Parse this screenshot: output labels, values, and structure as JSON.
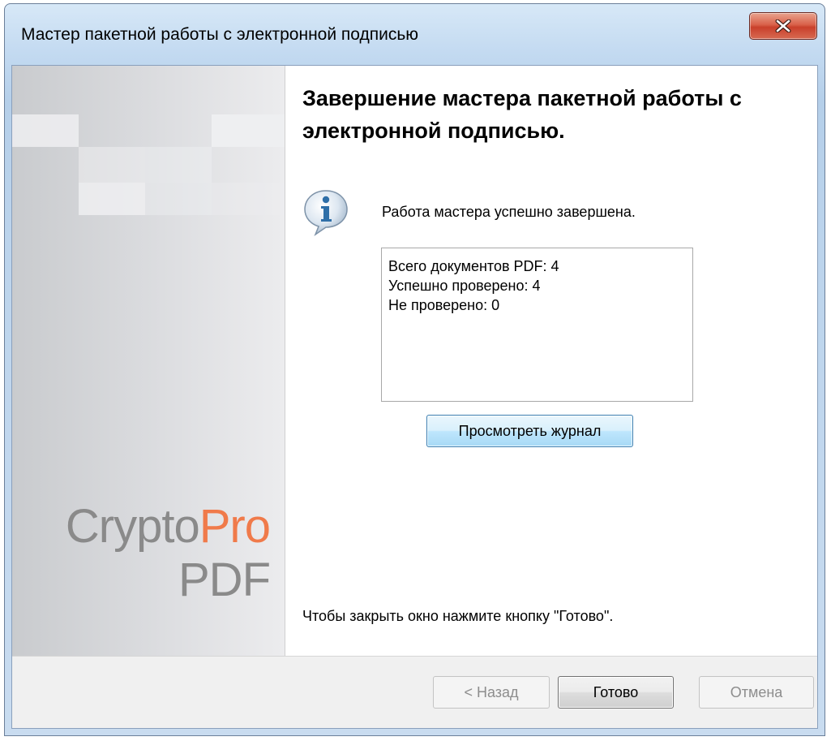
{
  "window": {
    "title": "Мастер пакетной работы с электронной подписью"
  },
  "logo": {
    "part1": "Crypto",
    "part2": "Pro",
    "part3": "PDF"
  },
  "main": {
    "heading": "Завершение мастера пакетной работы с электронной подписью.",
    "status_message": "Работа мастера успешно завершена.",
    "results": [
      "Всего документов PDF: 4",
      "Успешно проверено: 4",
      "Не проверено: 0"
    ],
    "view_log_label": "Просмотреть журнал",
    "hint": "Чтобы закрыть окно нажмите кнопку \"Готово\"."
  },
  "footer": {
    "back_label": "< Назад",
    "finish_label": "Готово",
    "cancel_label": "Отмена"
  },
  "colors": {
    "brand_accent": "#f07a4a",
    "close_button": "#c9402b",
    "info_icon": "#2f6fa8"
  },
  "icons": {
    "close": "close-icon",
    "info": "info-icon"
  }
}
